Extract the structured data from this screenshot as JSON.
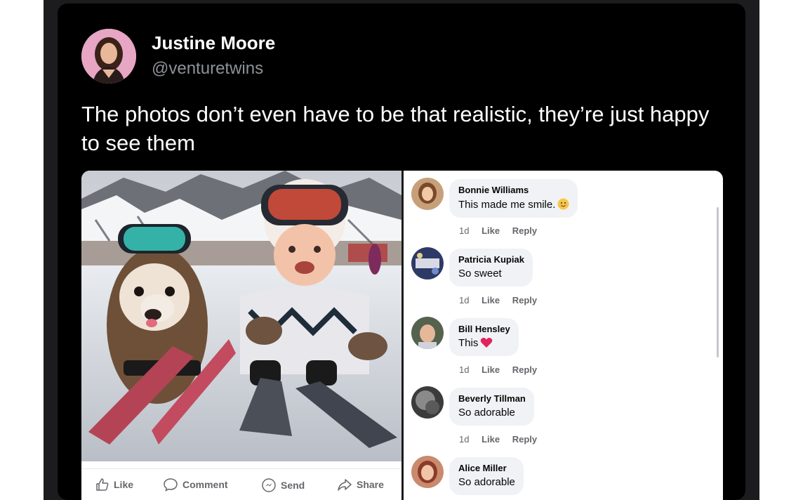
{
  "tweet": {
    "author_name": "Justine Moore",
    "author_handle": "@venturetwins",
    "text": "The photos don’t even have to be that realistic, they’re just happy to see them"
  },
  "post": {
    "actions": [
      {
        "label": "Like",
        "icon": "thumbs-up-icon"
      },
      {
        "label": "Comment",
        "icon": "comment-icon"
      },
      {
        "label": "Send",
        "icon": "messenger-icon"
      },
      {
        "label": "Share",
        "icon": "share-icon"
      }
    ],
    "comments": [
      {
        "name": "Bonnie Williams",
        "text": "This made me smile.",
        "emoji": "smiling-face-emoji",
        "time": "1d",
        "like": "Like",
        "reply": "Reply"
      },
      {
        "name": "Patricia Kupiak",
        "text": "So sweet",
        "time": "1d",
        "like": "Like",
        "reply": "Reply"
      },
      {
        "name": "Bill Hensley",
        "text": "This",
        "emoji": "red-heart-emoji",
        "time": "1d",
        "like": "Like",
        "reply": "Reply"
      },
      {
        "name": "Beverly Tillman",
        "text": "So adorable",
        "time": "1d",
        "like": "Like",
        "reply": "Reply"
      },
      {
        "name": "Alice Miller",
        "text": "So adorable"
      }
    ]
  },
  "colors": {
    "card_background": "#000000",
    "meta_grey": "#65676b",
    "bubble_grey": "#f0f2f5",
    "heart_red": "#e0245e"
  }
}
